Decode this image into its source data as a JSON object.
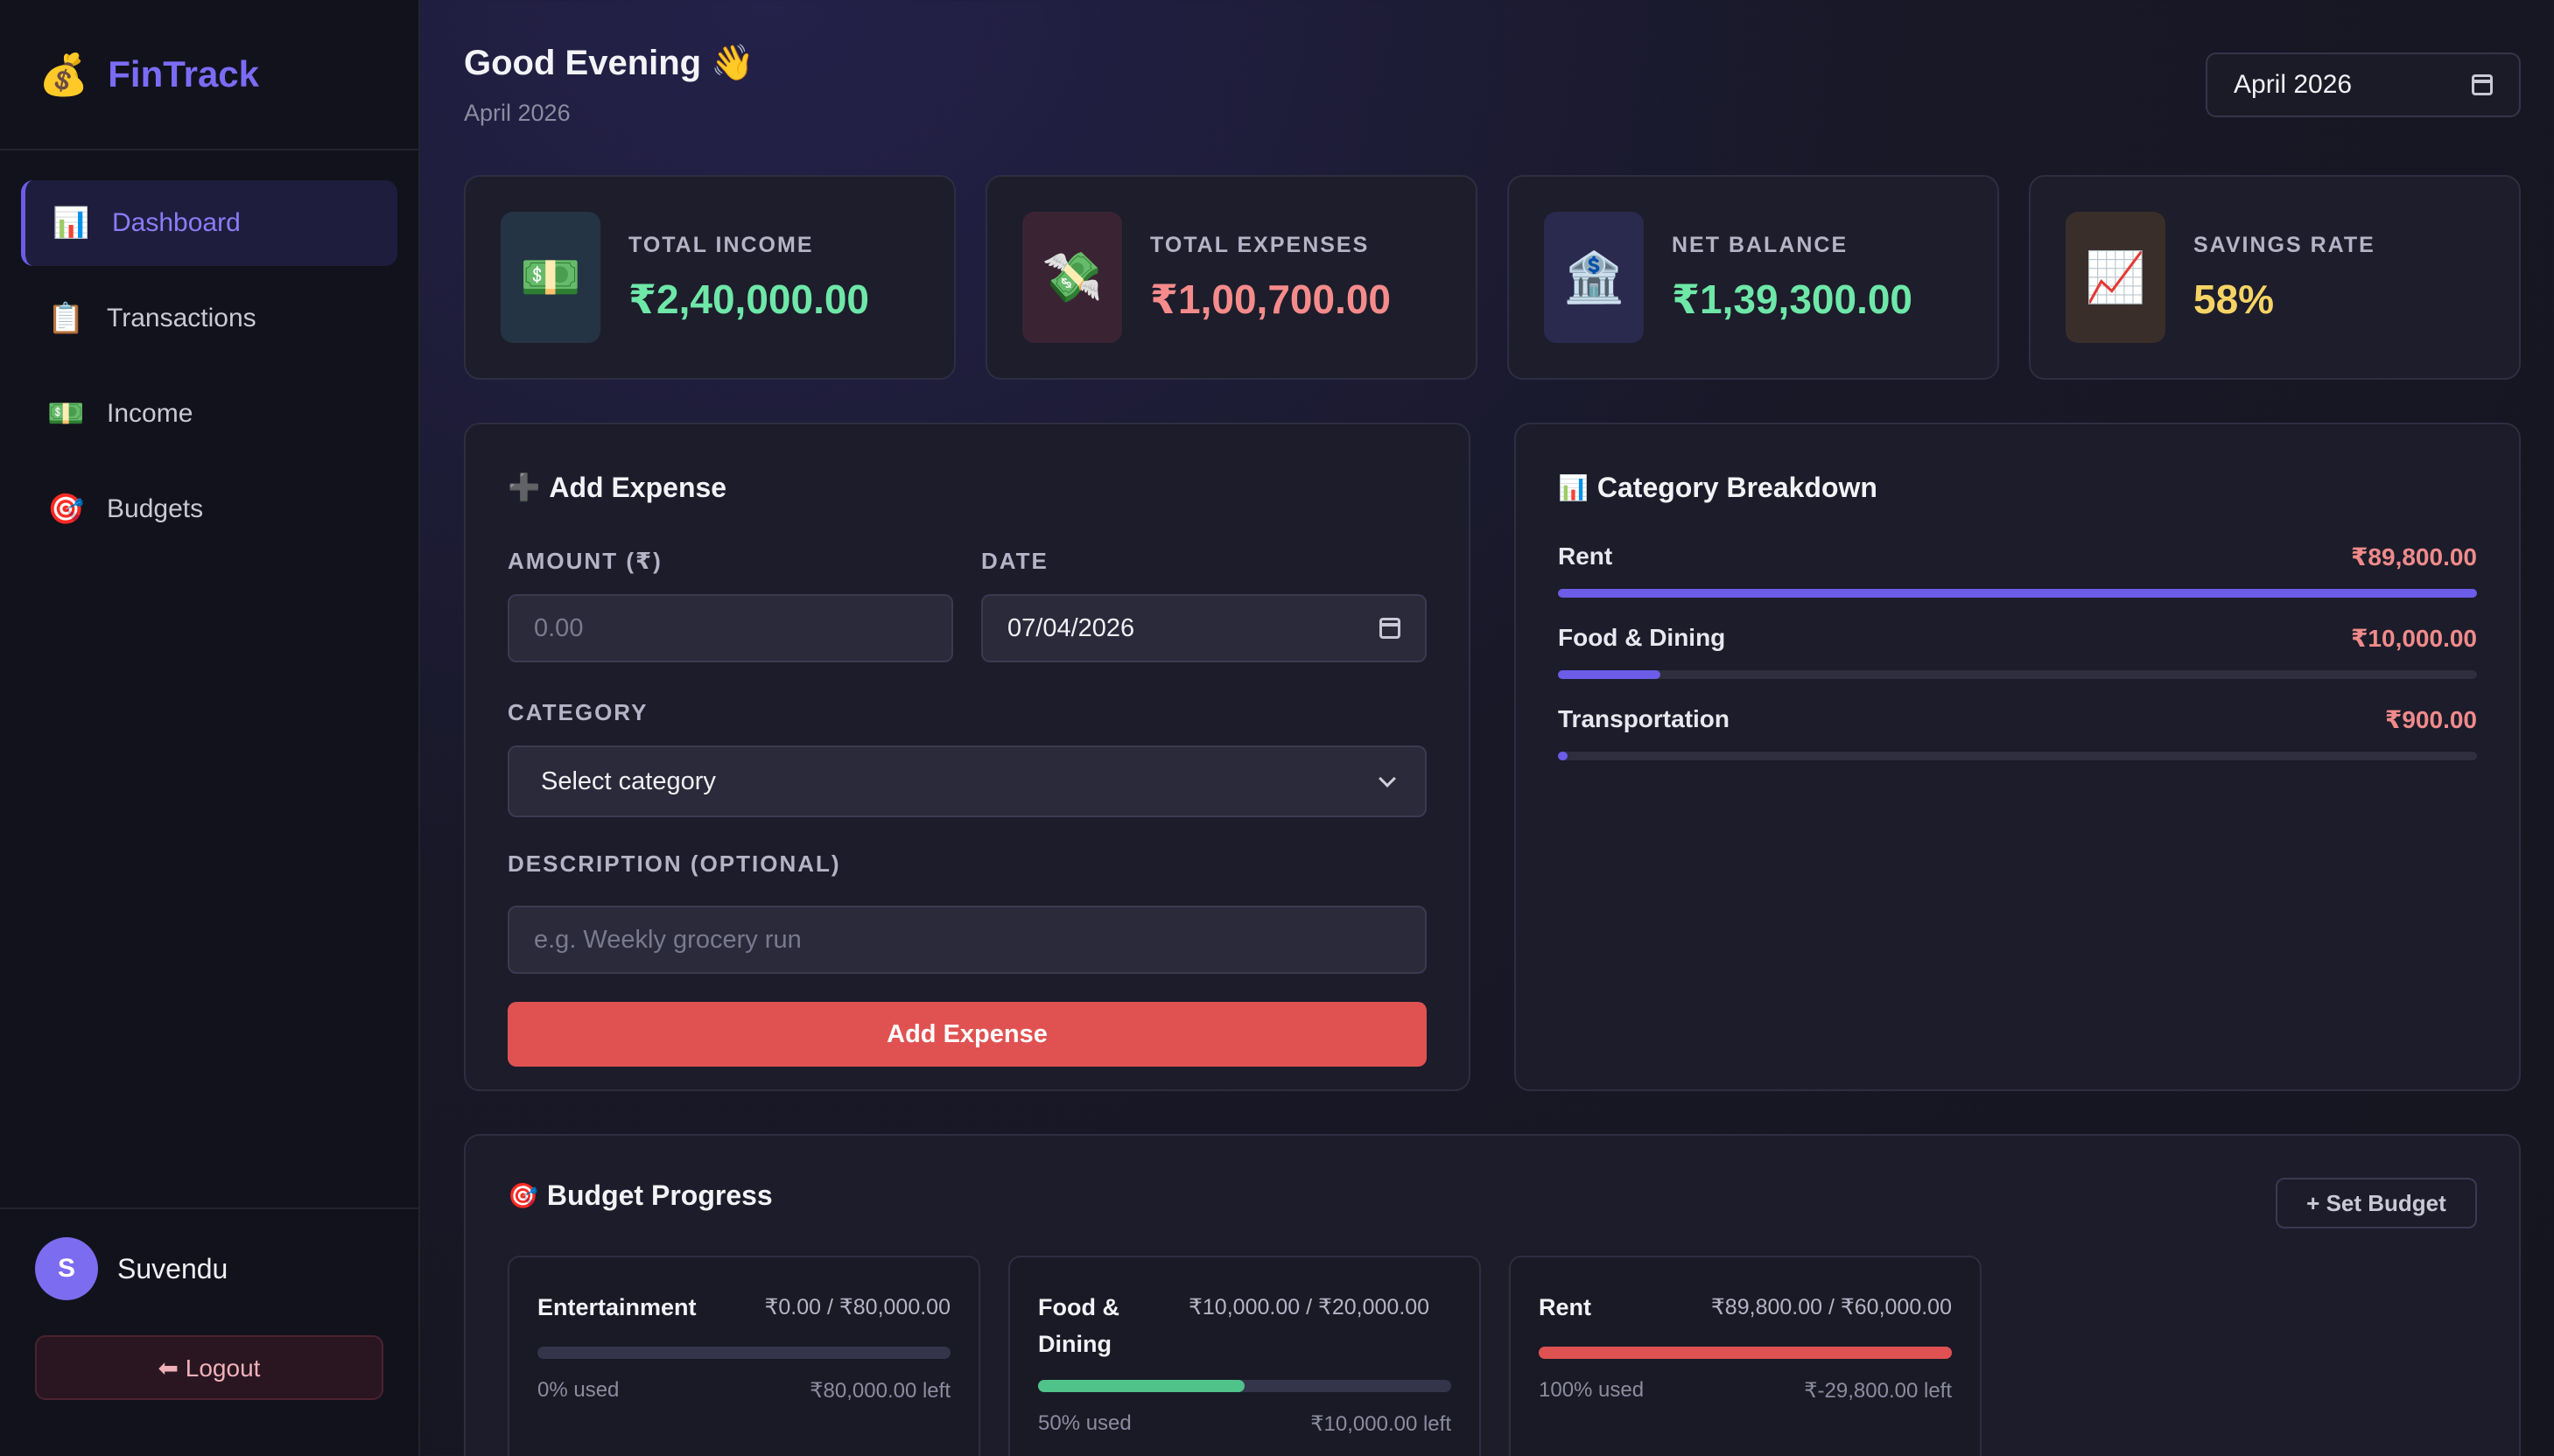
{
  "brand": {
    "name": "FinTrack",
    "icon": "money-bag-icon"
  },
  "nav": {
    "items": [
      {
        "label": "Dashboard",
        "icon": "📊",
        "active": true
      },
      {
        "label": "Transactions",
        "icon": "📋",
        "active": false
      },
      {
        "label": "Income",
        "icon": "💵",
        "active": false
      },
      {
        "label": "Budgets",
        "icon": "🎯",
        "active": false
      }
    ]
  },
  "user": {
    "initial": "S",
    "name": "Suvendu",
    "logout_label": "⬅ Logout"
  },
  "header": {
    "greeting": "Good Evening 👋",
    "subtitle": "April 2026",
    "month_picker": "April  2026"
  },
  "stats": [
    {
      "label": "TOTAL INCOME",
      "value": "₹2,40,000.00",
      "icon": "💵",
      "color": "#6ee7a8",
      "icon_bg": "#243444"
    },
    {
      "label": "TOTAL EXPENSES",
      "value": "₹1,00,700.00",
      "icon": "💸",
      "color": "#f58b8b",
      "icon_bg": "#3a2433"
    },
    {
      "label": "NET BALANCE",
      "value": "₹1,39,300.00",
      "icon": "🏦",
      "color": "#6ee7a8",
      "icon_bg": "#2a2a4e"
    },
    {
      "label": "SAVINGS RATE",
      "value": "58%",
      "icon": "📈",
      "color": "#f6d365",
      "icon_bg": "#3a2e2a"
    }
  ],
  "form": {
    "title": "Add Expense",
    "title_icon": "➕",
    "amount_label": "AMOUNT (₹)",
    "amount_placeholder": "0.00",
    "date_label": "DATE",
    "date_value": "07/04/2026",
    "category_label": "CATEGORY",
    "category_value": "Select category",
    "description_label": "DESCRIPTION (OPTIONAL)",
    "description_placeholder": "e.g. Weekly grocery run",
    "submit_label": "Add Expense"
  },
  "breakdown": {
    "title": "Category Breakdown",
    "title_icon": "📊",
    "items": [
      {
        "name": "Rent",
        "amount": "₹89,800.00",
        "fraction": 1.0
      },
      {
        "name": "Food & Dining",
        "amount": "₹10,000.00",
        "fraction": 0.111
      },
      {
        "name": "Transportation",
        "amount": "₹900.00",
        "fraction": 0.01
      }
    ]
  },
  "budget": {
    "title": "Budget Progress",
    "title_icon": "🎯",
    "set_label": "+ Set Budget",
    "items": [
      {
        "name": "Entertainment",
        "nums": "₹0.00 / ₹80,000.00",
        "used": "0% used",
        "left": "₹80,000.00 left",
        "fraction": 0,
        "color": "#34344a"
      },
      {
        "name": "Food & Dining",
        "nums": "₹10,000.00 / ₹20,000.00",
        "used": "50% used",
        "left": "₹10,000.00 left",
        "fraction": 0.5,
        "color": "#4fc38a"
      },
      {
        "name": "Rent",
        "nums": "₹89,800.00 / ₹60,000.00",
        "used": "100% used",
        "left": "₹-29,800.00 left",
        "fraction": 1.0,
        "color": "#e05252"
      }
    ]
  }
}
